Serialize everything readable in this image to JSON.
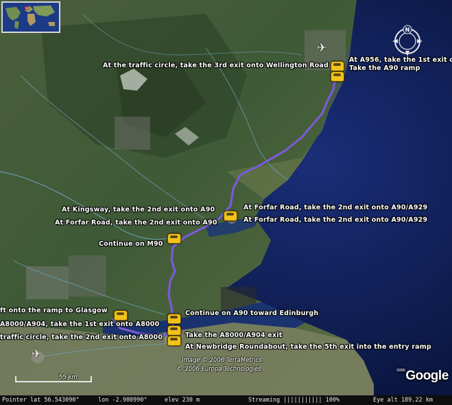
{
  "map": {
    "route_color": "#7a5bd6",
    "sea_color": "#0b1a4a",
    "land_color": "#3d5a36"
  },
  "directions": [
    {
      "text": "At A956, take the 1st exit o"
    },
    {
      "text": "Take the A90 ramp"
    },
    {
      "text": "At the traffic circle, take the 3rd exit onto Wellington Road"
    },
    {
      "text": "At Kingsway, take the 2nd exit onto A90"
    },
    {
      "text": "At Forfar Road, take the 2nd exit onto A90/A929"
    },
    {
      "text": "At Forfar Road, take the 2nd exit onto A90"
    },
    {
      "text": "At Forfar Road, take the 2nd exit onto A90/A929"
    },
    {
      "text": "Continue on M90"
    },
    {
      "text": "Continue on A90 toward Edinburgh"
    },
    {
      "text": "ft onto the ramp to Glasgow"
    },
    {
      "text": "A8000/A904, take the 1st exit onto A8000"
    },
    {
      "text": "traffic circle, take the 2nd exit onto A8000"
    },
    {
      "text": "Take the A8000/A904 exit"
    },
    {
      "text": "At Newbridge Roundabout, take the 5th exit into the  entry ramp"
    }
  ],
  "credits": {
    "line1": "Image © 2006 TerraMetrics",
    "line2": "© 2006 Europa Technologies"
  },
  "scale": {
    "label": "55 km"
  },
  "compass": {
    "label": "N"
  },
  "logo": {
    "prefix": "©2006",
    "text": "Google"
  },
  "status": {
    "pointer": "Pointer lat   56.543090°",
    "lon": "lon   -2.980990°",
    "elev": "elev  230 m",
    "streaming": "Streaming  ||||||||||| 100%",
    "eye": "Eye alt     189.22 km"
  }
}
